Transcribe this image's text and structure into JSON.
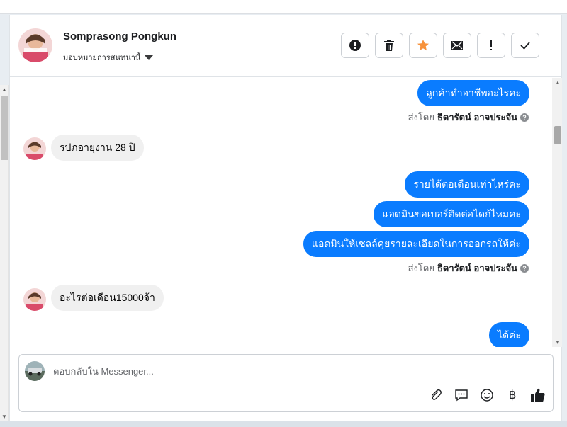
{
  "header": {
    "contact_name": "Somprasong Pongkun",
    "assign_label": "มอบหมายการสนทนานี้"
  },
  "actions": [
    {
      "name": "report-button",
      "icon": "alert-circle-icon"
    },
    {
      "name": "delete-button",
      "icon": "trash-icon"
    },
    {
      "name": "star-button",
      "icon": "star-icon",
      "color": "#f7923b"
    },
    {
      "name": "mail-button",
      "icon": "envelope-icon"
    },
    {
      "name": "follow-up-button",
      "icon": "exclamation-icon"
    },
    {
      "name": "done-button",
      "icon": "check-icon"
    }
  ],
  "messages": {
    "m1": "ลูกค้าทำอาชีพอะไรคะ",
    "sent_prefix": "ส่งโดย",
    "sender": "ธิดารัตน์ อาจประจัน",
    "m2": "รปภอายุงาน 28 ปี",
    "m3": "รายได้ต่อเดือนเท่าไหร่คะ",
    "m4": "แอดมินขอเบอร์ติดต่อไดก้ไหมคะ",
    "m5": "แอดมินให้เซลล์คุยรายละเอียดในการออกรถให้ค่ะ",
    "m6": "อะไรต่อเดือน15000จ้า",
    "m7": "ได้ค่ะ"
  },
  "composer": {
    "placeholder": "ตอบกลับใน Messenger...",
    "baht_symbol": "฿"
  },
  "colors": {
    "outgoing_bubble": "#0a7cff",
    "incoming_bubble": "#f0f0f0",
    "star": "#f7923b"
  }
}
